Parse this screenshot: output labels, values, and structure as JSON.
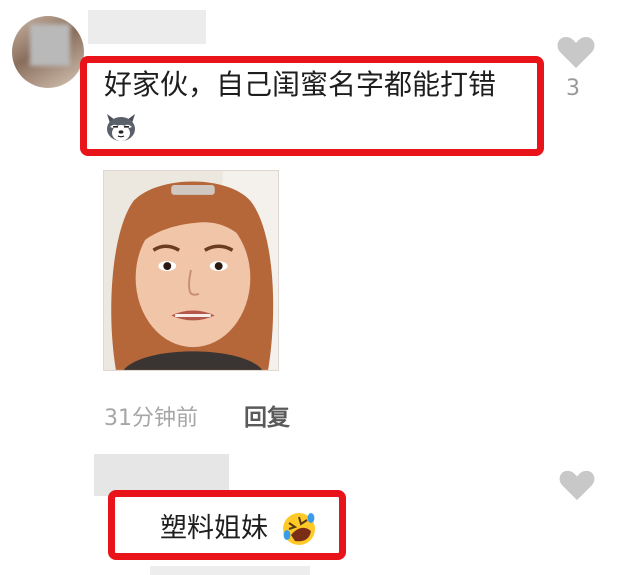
{
  "comments": [
    {
      "text": "好家伙，自己闺蜜名字都能打错",
      "emoji": "husky-dog-icon",
      "like_count": "3",
      "image": "reaction-photo",
      "time": "31分钟前",
      "reply_label": "回复"
    },
    {
      "text": "塑料姐妹",
      "emoji": "rolling-laughing-icon"
    }
  ],
  "colors": {
    "highlight": "#e8141a",
    "text": "#1e1e1e",
    "meta": "#a6a6a6",
    "heart": "#c8c8c8"
  }
}
